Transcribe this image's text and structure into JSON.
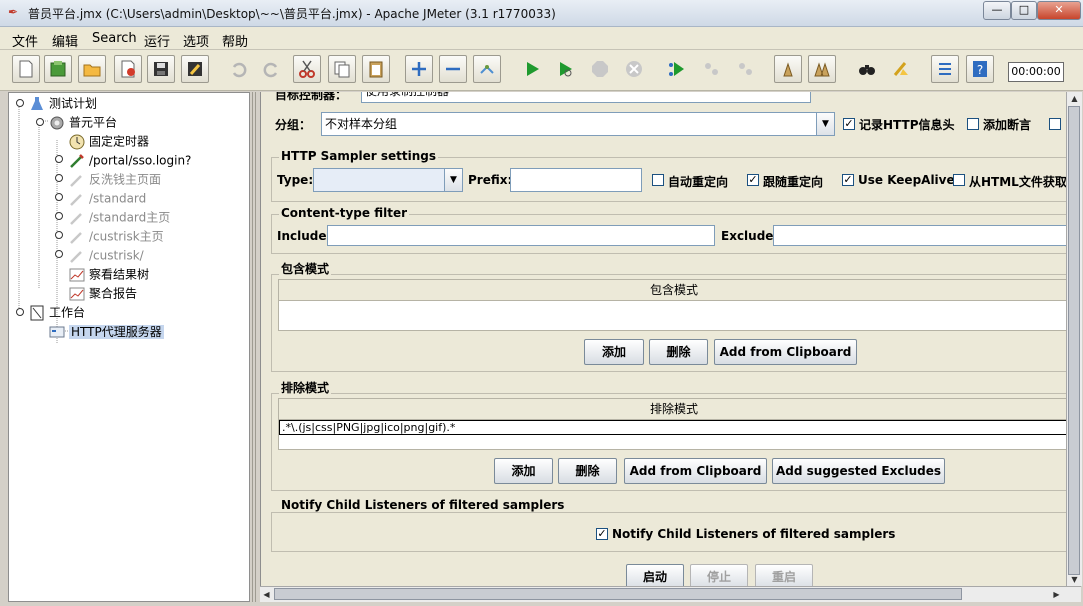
{
  "window": {
    "title": "普员平台.jmx (C:\\Users\\admin\\Desktop\\~~\\普员平台.jmx) - Apache JMeter (3.1 r1770033)"
  },
  "menu": [
    "文件",
    "编辑",
    "Search",
    "运行",
    "选项",
    "帮助"
  ],
  "timer": "00:00:00",
  "tree": {
    "test_plan": "测试计划",
    "thread_group": "普元平台",
    "items": [
      {
        "label": "固定定时器",
        "state": "enabled"
      },
      {
        "label": "/portal/sso.login?",
        "state": "enabled"
      },
      {
        "label": "反洗钱主页面",
        "state": "disabled"
      },
      {
        "label": "/standard",
        "state": "disabled"
      },
      {
        "label": "/standard主页",
        "state": "disabled"
      },
      {
        "label": "/custrisk主页",
        "state": "disabled"
      },
      {
        "label": "/custrisk/",
        "state": "disabled"
      },
      {
        "label": "察看结果树",
        "state": "enabled"
      },
      {
        "label": "聚合报告",
        "state": "enabled"
      }
    ],
    "workbench": "工作台",
    "proxy": "HTTP代理服务器"
  },
  "form": {
    "target_controller_label": "目标控制器：",
    "target_controller_value": "使用录制控制器",
    "grouping_label": "分组：",
    "grouping_value": "不对样本分组",
    "record_headers": "记录HTTP信息头",
    "add_assertions": "添加断言",
    "sampler_group": "HTTP Sampler settings",
    "type_label": "Type:",
    "type_value": "",
    "prefix_label": "Prefix:",
    "prefix_value": "",
    "auto_redirect": "自动重定向",
    "follow_redirect": "跟随重定向",
    "keepalive": "Use KeepAlive",
    "retrieve_embedded": "从HTML文件获取",
    "content_type_group": "Content-type filter",
    "include_label": "Include:",
    "exclude_label": "Exclude:",
    "include_patterns": {
      "title": "包含模式",
      "header": "包含模式",
      "rows": []
    },
    "exclude_patterns": {
      "title": "排除模式",
      "header": "排除模式",
      "rows": [
        ".*\\.(js|css|PNG|jpg|ico|png|gif).*"
      ]
    },
    "notify_group": "Notify Child Listeners of filtered samplers",
    "notify_checkbox": "Notify Child Listeners of filtered samplers",
    "buttons": {
      "add": "添加",
      "delete": "删除",
      "add_clipboard": "Add from Clipboard",
      "add_suggested": "Add suggested Excludes",
      "start": "启动",
      "stop": "停止",
      "restart": "重启"
    }
  }
}
